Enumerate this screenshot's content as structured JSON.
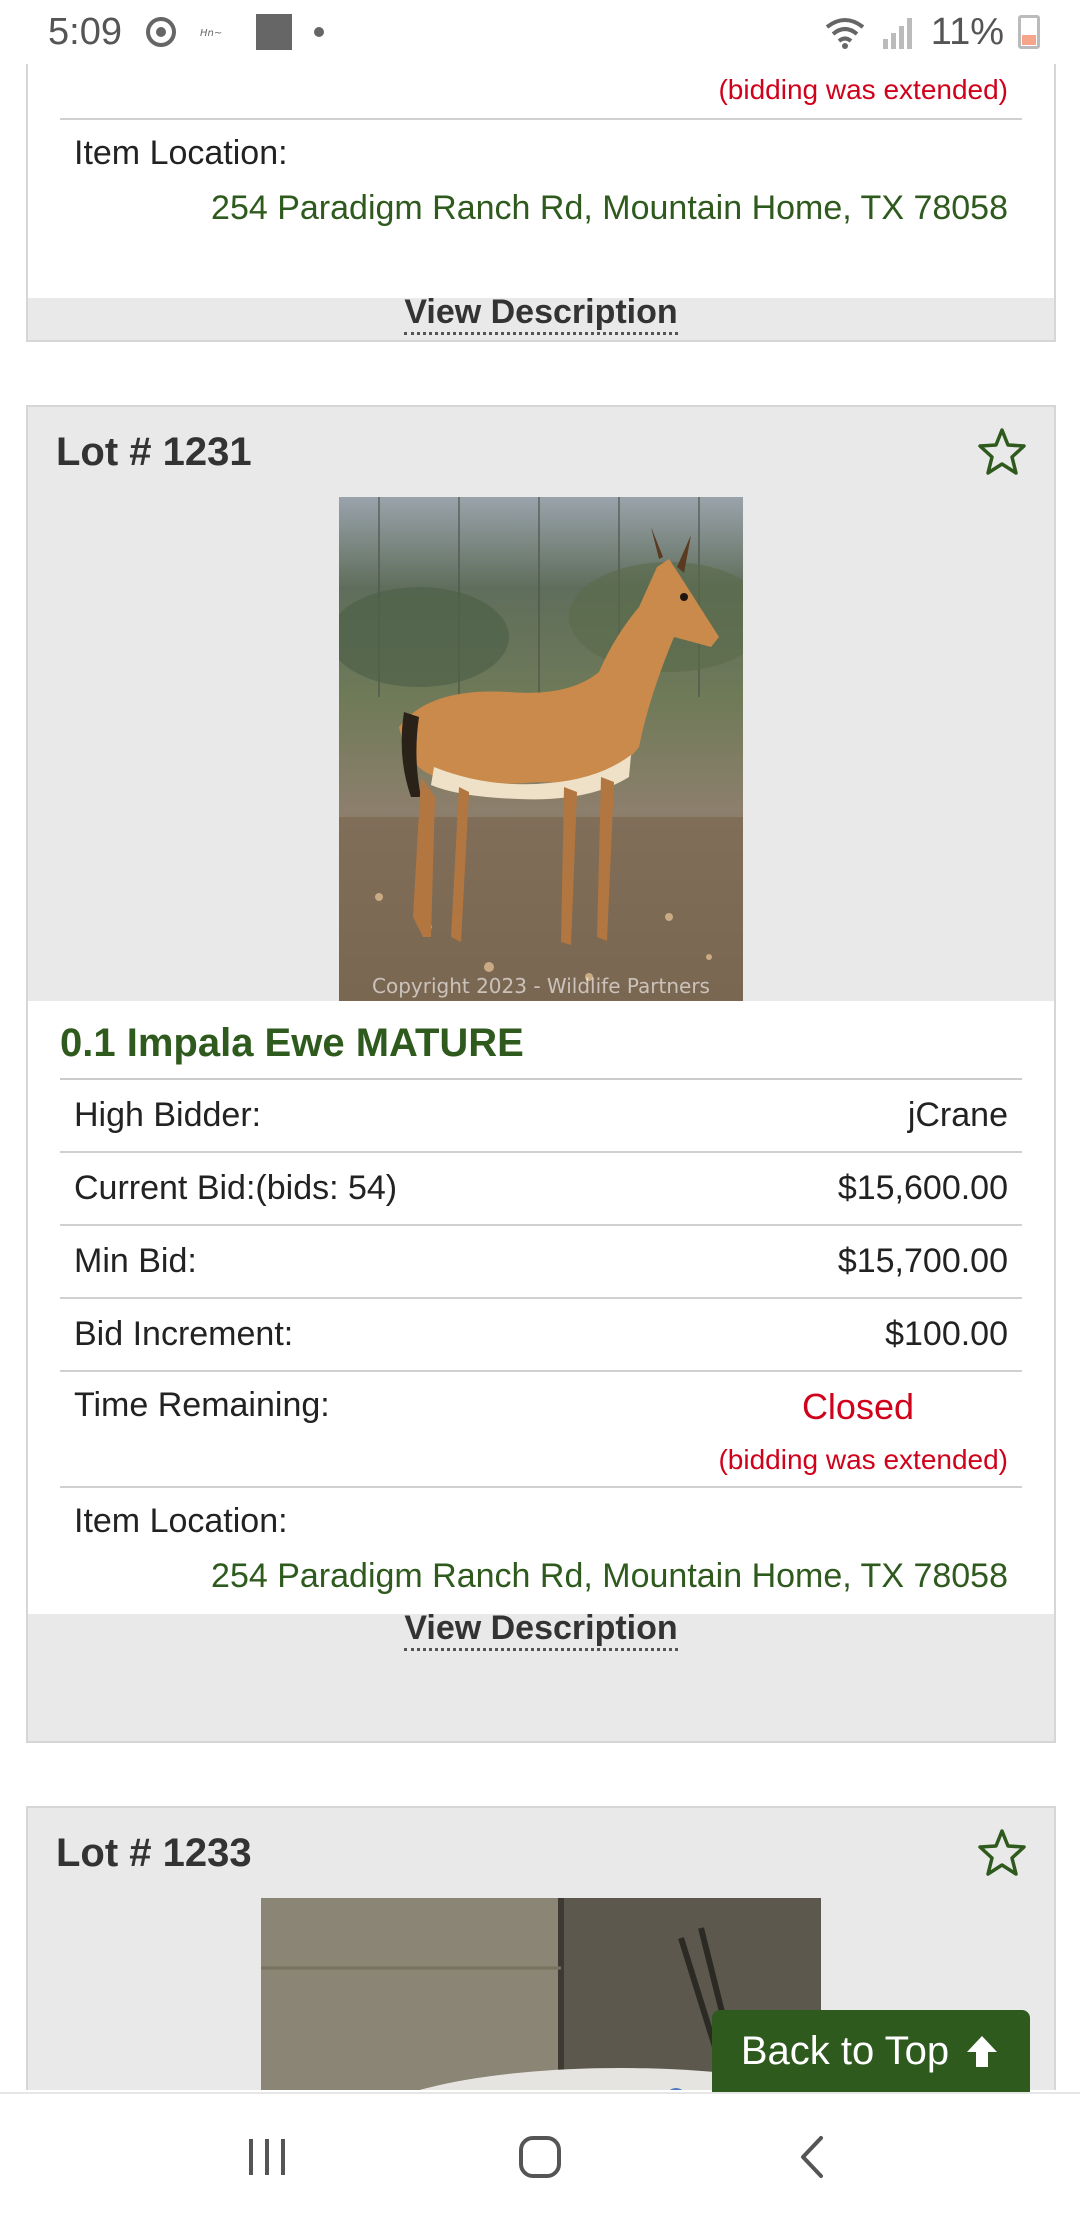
{
  "status_bar": {
    "time": "5:09",
    "battery": "11%"
  },
  "prev_lot": {
    "bidding_note": "(bidding was extended)",
    "location_label": "Item Location:",
    "location": "254 Paradigm Ranch Rd, Mountain Home, TX 78058",
    "view_description": "View Description"
  },
  "lot_1231": {
    "title": "Lot # 1231",
    "photo_caption": "Copyright 2023 - Wildlife Partners",
    "item_title": "0.1 Impala Ewe MATURE",
    "high_bidder_label": "High Bidder:",
    "high_bidder": "jCrane",
    "current_bid_label": "Current Bid:(bids: 54)",
    "current_bid": "$15,600.00",
    "min_bid_label": "Min Bid:",
    "min_bid": "$15,700.00",
    "bid_increment_label": "Bid Increment:",
    "bid_increment": "$100.00",
    "time_remaining_label": "Time Remaining:",
    "time_remaining": "Closed",
    "bidding_note": "(bidding was extended)",
    "location_label": "Item Location:",
    "location": "254 Paradigm Ranch Rd, Mountain Home, TX 78058",
    "view_description": "View Description"
  },
  "lot_1233": {
    "title": "Lot # 1233"
  },
  "back_to_top": "Back to Top",
  "colors": {
    "accent_green": "#2f5a1e",
    "alert_red": "#d0021b",
    "card_gray": "#e9e9e9"
  },
  "icons": [
    "star-icon",
    "arrow-up-icon",
    "recents-icon",
    "home-icon",
    "back-icon",
    "wifi-icon",
    "signal-icon",
    "battery-icon"
  ]
}
